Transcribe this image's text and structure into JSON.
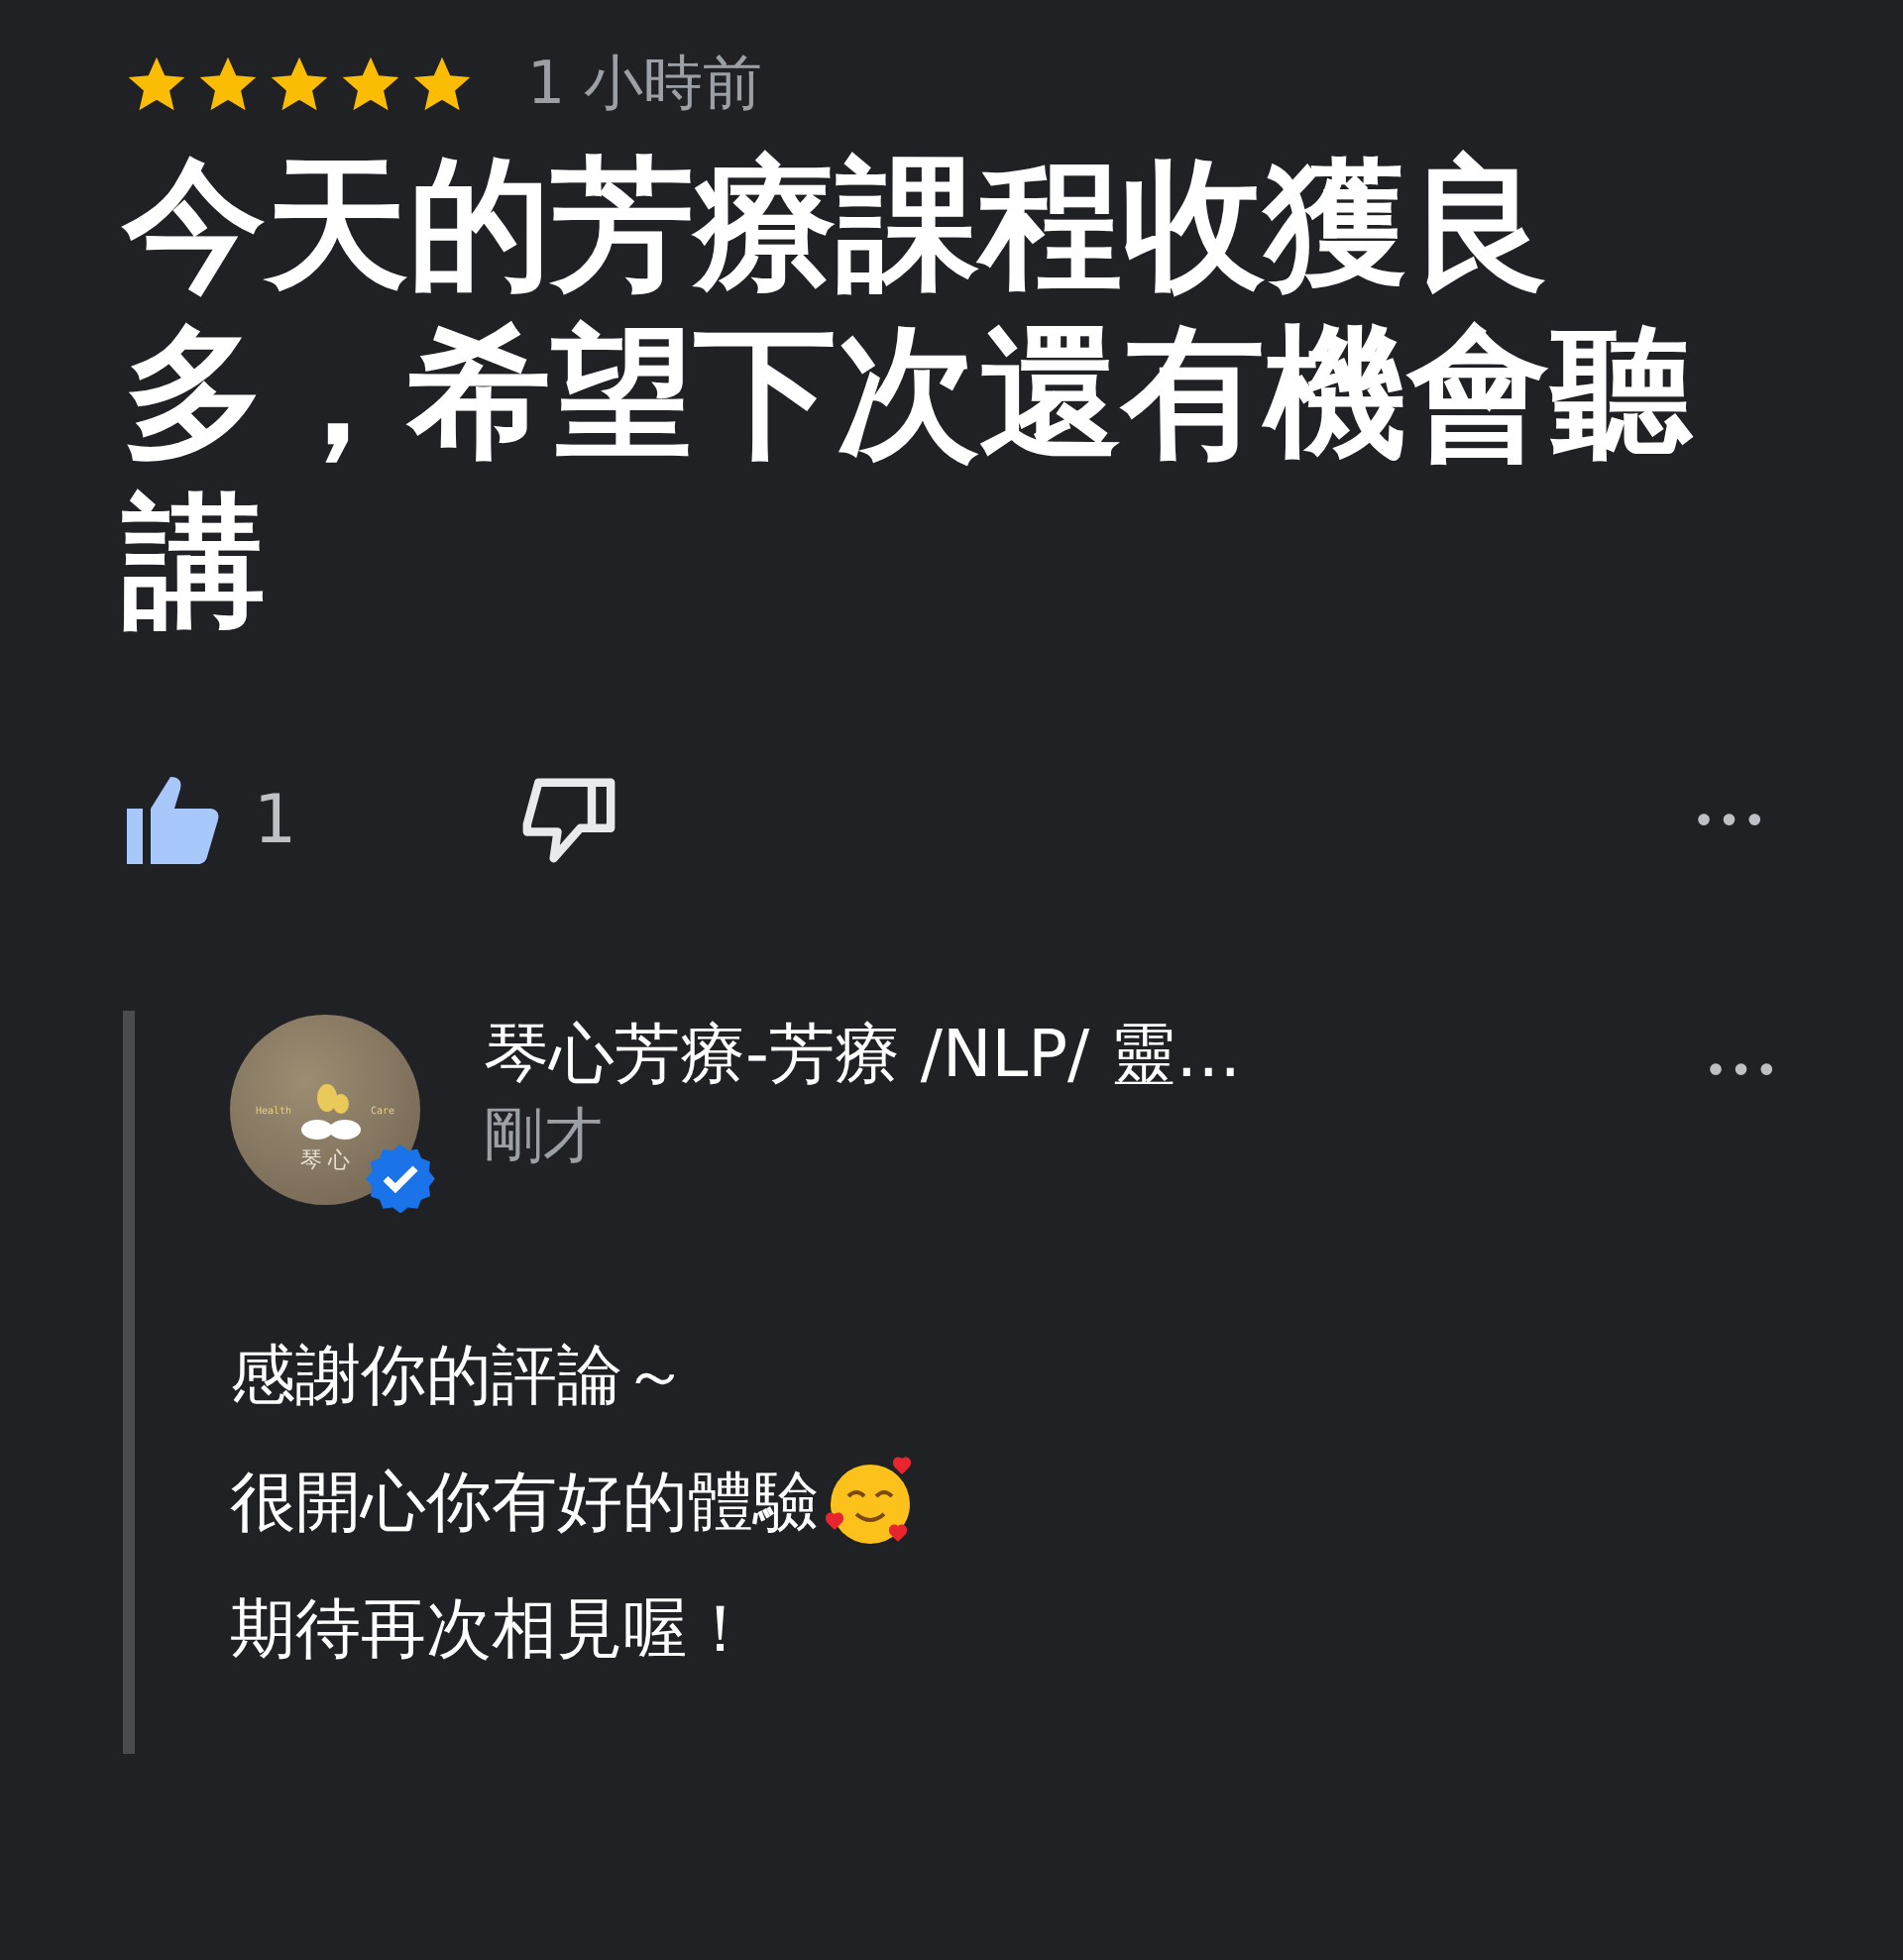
{
  "review": {
    "stars": 5,
    "time": "1 小時前",
    "text": "今天的芳療課程收獲良多，希望下次還有機會聽講"
  },
  "actions": {
    "liked": true,
    "like_count": "1",
    "more": "•••"
  },
  "reply": {
    "logo": {
      "left": "Health",
      "right": "Care",
      "name": "琴 心"
    },
    "verified": true,
    "author": "琴心芳療-芳療 /NLP/ 靈…",
    "time": "剛才",
    "more": "•••",
    "lines": [
      {
        "text": "感謝你的評論～",
        "emoji": false
      },
      {
        "text": "很開心你有好的體驗",
        "emoji": true
      },
      {
        "text": "期待再次相見喔！",
        "emoji": false
      }
    ]
  }
}
